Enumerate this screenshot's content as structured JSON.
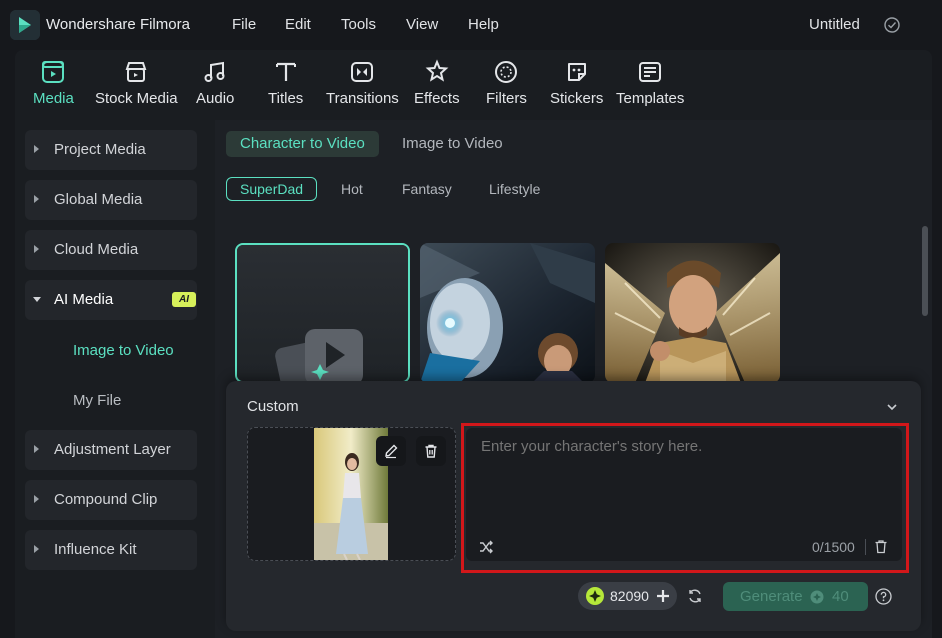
{
  "titlebar": {
    "app_name": "Wondershare Filmora",
    "menus": [
      "File",
      "Edit",
      "Tools",
      "View",
      "Help"
    ],
    "doc_title": "Untitled"
  },
  "toolbar": {
    "tools": [
      {
        "label": "Media",
        "icon": "media-icon"
      },
      {
        "label": "Stock Media",
        "icon": "stock-media-icon"
      },
      {
        "label": "Audio",
        "icon": "audio-icon"
      },
      {
        "label": "Titles",
        "icon": "titles-icon"
      },
      {
        "label": "Transitions",
        "icon": "transitions-icon"
      },
      {
        "label": "Effects",
        "icon": "effects-icon"
      },
      {
        "label": "Filters",
        "icon": "filters-icon"
      },
      {
        "label": "Stickers",
        "icon": "stickers-icon"
      },
      {
        "label": "Templates",
        "icon": "templates-icon"
      }
    ],
    "active": "Media"
  },
  "sidebar": {
    "items": [
      {
        "label": "Project Media"
      },
      {
        "label": "Global Media"
      },
      {
        "label": "Cloud Media"
      },
      {
        "label": "AI Media",
        "badge": "AI",
        "expanded": true
      },
      {
        "label": "Adjustment Layer"
      },
      {
        "label": "Compound Clip"
      },
      {
        "label": "Influence Kit"
      }
    ],
    "sub_items": [
      "Image to Video",
      "My File"
    ],
    "active_sub": "Image to Video"
  },
  "content": {
    "tabs": [
      "Character to Video",
      "Image to Video"
    ],
    "active_tab": "Character to Video",
    "categories": [
      "SuperDad",
      "Hot",
      "Fantasy",
      "Lifestyle"
    ],
    "active_category": "SuperDad"
  },
  "custom_panel": {
    "title": "Custom",
    "story_placeholder": "Enter your character's story here.",
    "char_count": "0/1500",
    "credits": "82090",
    "generate_label": "Generate",
    "generate_cost": "40"
  },
  "colors": {
    "accent": "#5be0c1",
    "highlight_border": "#d2171a",
    "ai_badge": "#d7f05a"
  }
}
